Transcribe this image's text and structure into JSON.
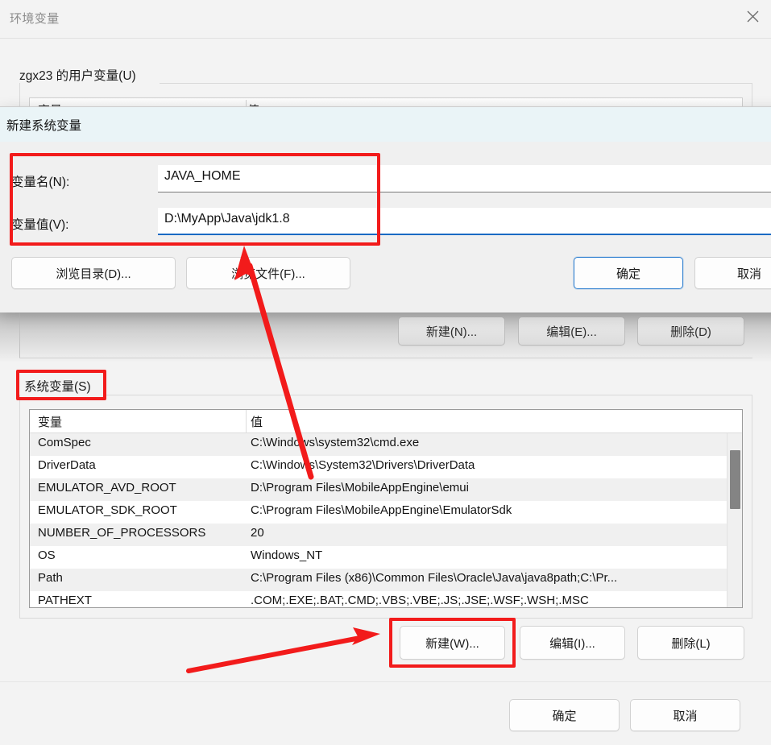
{
  "window": {
    "title": "环境变量",
    "close_icon": "close-icon"
  },
  "user_section": {
    "group_label": "zgx23 的用户变量(U)",
    "columns": [
      "变量",
      "值"
    ]
  },
  "mid_buttons": [
    {
      "name": "new",
      "label": "新建(N)..."
    },
    {
      "name": "edit",
      "label": "编辑(E)..."
    },
    {
      "name": "delete",
      "label": "删除(D)"
    }
  ],
  "system_section": {
    "group_label": "系统变量(S)",
    "columns": [
      "变量",
      "值"
    ],
    "rows": [
      {
        "variable": "ComSpec",
        "value": "C:\\Windows\\system32\\cmd.exe"
      },
      {
        "variable": "DriverData",
        "value": "C:\\Windows\\System32\\Drivers\\DriverData"
      },
      {
        "variable": "EMULATOR_AVD_ROOT",
        "value": "D:\\Program Files\\MobileAppEngine\\emui"
      },
      {
        "variable": "EMULATOR_SDK_ROOT",
        "value": "C:\\Program Files\\MobileAppEngine\\EmulatorSdk"
      },
      {
        "variable": "NUMBER_OF_PROCESSORS",
        "value": "20"
      },
      {
        "variable": "OS",
        "value": "Windows_NT"
      },
      {
        "variable": "Path",
        "value": "C:\\Program Files (x86)\\Common Files\\Oracle\\Java\\java8path;C:\\Pr..."
      },
      {
        "variable": "PATHEXT",
        "value": ".COM;.EXE;.BAT;.CMD;.VBS;.VBE;.JS;.JSE;.WSF;.WSH;.MSC"
      }
    ]
  },
  "lower_buttons": [
    {
      "name": "new",
      "label": "新建(W)..."
    },
    {
      "name": "edit",
      "label": "编辑(I)..."
    },
    {
      "name": "delete",
      "label": "删除(L)"
    }
  ],
  "footer_buttons": {
    "ok": "确定",
    "cancel": "取消"
  },
  "modal": {
    "title": "新建系统变量",
    "name_label": "变量名(N):",
    "name_value": "JAVA_HOME",
    "value_label": "变量值(V):",
    "value_value": "D:\\MyApp\\Java\\jdk1.8",
    "browse_dir": "浏览目录(D)...",
    "browse_file": "浏览文件(F)...",
    "ok": "确定",
    "cancel": "取消"
  },
  "annotations": {
    "highlight_color": "#f21b1b",
    "accent_color": "#1a6bc4"
  }
}
